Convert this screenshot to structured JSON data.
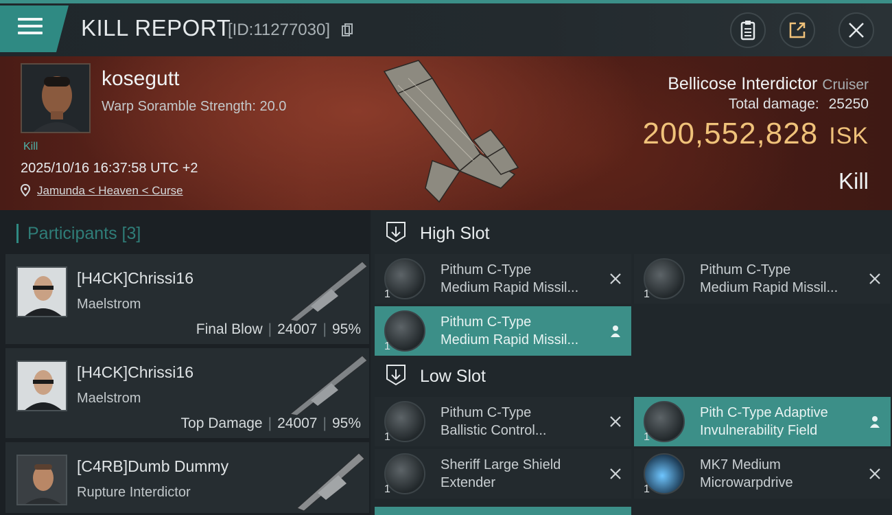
{
  "header": {
    "title": "KILL REPORT",
    "id_text": "[ID:11277030]"
  },
  "victim": {
    "name": "kosegutt",
    "warp_scramble": "Warp Soramble Strength: 20.0",
    "kill_label": "Kill",
    "datetime": "2025/10/16 16:37:58 UTC +2",
    "location": "Jamunda < Heaven < Curse",
    "ship_name": "Bellicose Interdictor",
    "ship_class": "Cruiser",
    "total_damage_label": "Total damage:",
    "total_damage": "25250",
    "isk_value": "200,552,828",
    "isk_unit": "ISK",
    "result": "Kill"
  },
  "participants": {
    "header": "Participants [3]",
    "rows": [
      {
        "name": "[H4CK]Chrissi16",
        "ship": "Maelstrom",
        "role": "Final Blow",
        "damage": "24007",
        "percent": "95%"
      },
      {
        "name": "[H4CK]Chrissi16",
        "ship": "Maelstrom",
        "role": "Top Damage",
        "damage": "24007",
        "percent": "95%"
      },
      {
        "name": "[C4RB]Dumb Dummy",
        "ship": "Rupture Interdictor",
        "role": "",
        "damage": "",
        "percent": ""
      }
    ]
  },
  "slots": {
    "high_label": "High Slot",
    "low_label": "Low Slot",
    "high": [
      {
        "qty": "1",
        "line1": "Pithum C-Type",
        "line2": "Medium Rapid Missil...",
        "state": "destroyed"
      },
      {
        "qty": "1",
        "line1": "Pithum C-Type",
        "line2": "Medium Rapid Missil...",
        "state": "destroyed"
      },
      {
        "qty": "1",
        "line1": "Pithum C-Type",
        "line2": "Medium Rapid Missil...",
        "state": "dropped"
      }
    ],
    "low": [
      {
        "qty": "1",
        "line1": "Pithum C-Type",
        "line2": "Ballistic Control...",
        "state": "destroyed"
      },
      {
        "qty": "1",
        "line1": "Pith C-Type Adaptive",
        "line2": "Invulnerability Field",
        "state": "dropped"
      },
      {
        "qty": "1",
        "line1": "Sheriff Large Shield",
        "line2": "Extender",
        "state": "destroyed"
      },
      {
        "qty": "1",
        "line1": "MK7 Medium",
        "line2": "Microwarpdrive",
        "state": "destroyed"
      }
    ]
  },
  "colors": {
    "accent": "#3c8f88",
    "isk": "#f0c27a"
  }
}
